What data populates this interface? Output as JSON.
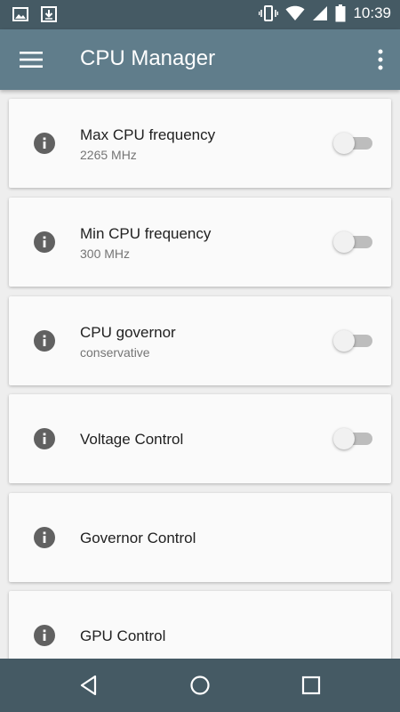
{
  "status_bar": {
    "time": "10:39",
    "icons": [
      "image-icon",
      "download-icon",
      "vibrate-icon",
      "wifi-icon",
      "signal-icon",
      "battery-icon"
    ]
  },
  "app_bar": {
    "title": "CPU Manager",
    "menu_icon": "hamburger-menu-icon",
    "overflow_icon": "more-vert-icon",
    "color": "#607d8b"
  },
  "items": [
    {
      "title": "Max CPU frequency",
      "subtitle": "2265 MHz",
      "has_switch": true,
      "switch_on": false
    },
    {
      "title": "Min CPU frequency",
      "subtitle": "300 MHz",
      "has_switch": true,
      "switch_on": false
    },
    {
      "title": "CPU governor",
      "subtitle": "conservative",
      "has_switch": true,
      "switch_on": false
    },
    {
      "title": "Voltage Control",
      "subtitle": "",
      "has_switch": true,
      "switch_on": false
    },
    {
      "title": "Governor Control",
      "subtitle": "",
      "has_switch": false
    },
    {
      "title": "GPU Control",
      "subtitle": "",
      "has_switch": false
    }
  ],
  "nav_bar": {
    "buttons": [
      "back-icon",
      "home-icon",
      "recents-icon"
    ],
    "color": "#455a64"
  }
}
